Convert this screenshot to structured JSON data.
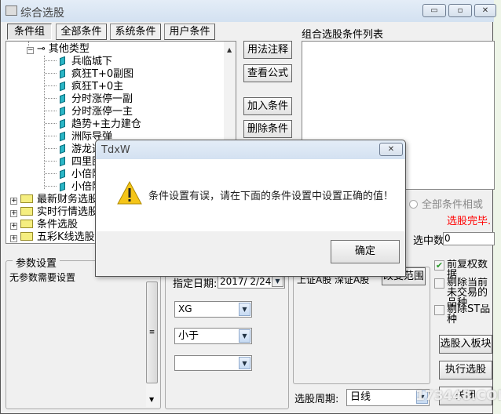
{
  "window": {
    "title": "综合选股",
    "min": "▭",
    "max": "▫",
    "close": "✕"
  },
  "tabs": [
    "条件组",
    "全部条件",
    "系统条件",
    "用户条件"
  ],
  "tree": {
    "group": "其他类型",
    "items": [
      "兵临城下",
      "疯狂T+0副图",
      "疯狂T+0主",
      "分时涨停一副",
      "分时涨停一主",
      "趋势+主力建仓",
      "洲际导弹",
      "游龙选股",
      "四里图",
      "小倍阳",
      "小倍阳"
    ],
    "folders": [
      "最新财务选股",
      "实时行情选股",
      "条件选股",
      "五彩K线选股"
    ]
  },
  "buttons": {
    "usage": "用法注释",
    "formula": "查看公式",
    "add": "加入条件",
    "delete": "删除条件",
    "to_block": "选股入板块",
    "execute": "执行选股",
    "close": "关闭",
    "change_range": "改变范围"
  },
  "condition_list": {
    "label": "组合选股条件列表"
  },
  "radio_or": "全部条件相或",
  "status": "选股完毕.",
  "status_color": "#ff0000",
  "selected_count": {
    "label": "选中数",
    "value": "0"
  },
  "params": {
    "title": "参数设置",
    "text": "无参数需要设置"
  },
  "date": {
    "label": "指定日期:",
    "value": "2017/ 2/24"
  },
  "combos": {
    "var": "XG",
    "op": "小于",
    "value": ""
  },
  "range_text": "上证A股 深证A股",
  "checkboxes": [
    {
      "label": "前复权数据",
      "checked": true
    },
    {
      "label": "剔除当前未交易的品种",
      "checked": false
    },
    {
      "label": "剔除ST品种",
      "checked": false
    }
  ],
  "period": {
    "label": "选股周期:",
    "value": "日线"
  },
  "watermark": "173448.COM",
  "dialog": {
    "title": "TdxW",
    "message": "条件设置有误，请在下面的条件设置中设置正确的值！",
    "ok": "确定",
    "close": "✕"
  }
}
